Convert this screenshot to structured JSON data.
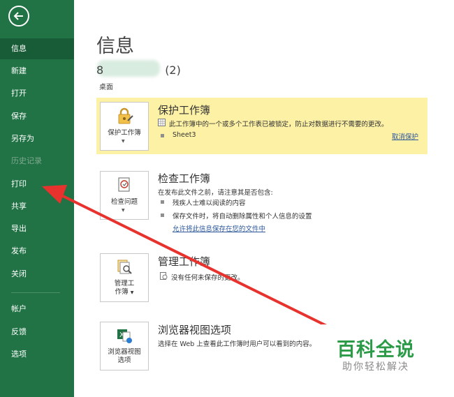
{
  "sidebar": {
    "items": [
      {
        "label": "信息",
        "state": "active"
      },
      {
        "label": "新建",
        "state": "normal"
      },
      {
        "label": "打开",
        "state": "normal"
      },
      {
        "label": "保存",
        "state": "normal"
      },
      {
        "label": "另存为",
        "state": "normal"
      },
      {
        "label": "历史记录",
        "state": "disabled"
      },
      {
        "label": "打印",
        "state": "normal"
      },
      {
        "label": "共享",
        "state": "normal"
      },
      {
        "label": "导出",
        "state": "normal"
      },
      {
        "label": "发布",
        "state": "normal"
      },
      {
        "label": "关闭",
        "state": "normal"
      },
      {
        "label": "帐户",
        "state": "normal"
      },
      {
        "label": "反馈",
        "state": "normal"
      },
      {
        "label": "选项",
        "state": "normal"
      }
    ]
  },
  "main": {
    "title": "信息",
    "file_name_visible": "(2)",
    "file_prefix_visible": "8",
    "file_location": "桌面",
    "protect": {
      "tile_label": "保护工作簿",
      "title": "保护工作簿",
      "line1": "此工作簿中的一个或多个工作表已被锁定，防止对数据进行不需要的更改。",
      "sheet": "Sheet3",
      "link": "取消保护"
    },
    "inspect": {
      "tile_label": "检查问题",
      "title": "检查工作簿",
      "line1": "在发布此文件之前，请注意其是否包含:",
      "bullet1": "残疾人士难以阅读的内容",
      "bullet2": "保存文件时，将自动删除属性和个人信息的设置",
      "link": "允许将此信息保存在您的文件中"
    },
    "manage": {
      "tile_label_1": "管理工",
      "tile_label_2": "作簿",
      "title": "管理工作簿",
      "line1": "没有任何未保存的更改。"
    },
    "browser": {
      "tile_label_1": "浏览器视图",
      "tile_label_2": "选项",
      "title": "浏览器视图选项",
      "line1": "选择在 Web 上查看此工作簿时用户可以看到的内容。"
    }
  },
  "watermark": {
    "main": "百科全说",
    "sub": "助你轻松解决"
  },
  "colors": {
    "sidebar": "#217346",
    "sidebar_active": "#185c37",
    "highlight": "#fdf1a5",
    "arrow": "#e8322d",
    "link": "#2b579a",
    "watermark_green": "#2b9b47"
  }
}
